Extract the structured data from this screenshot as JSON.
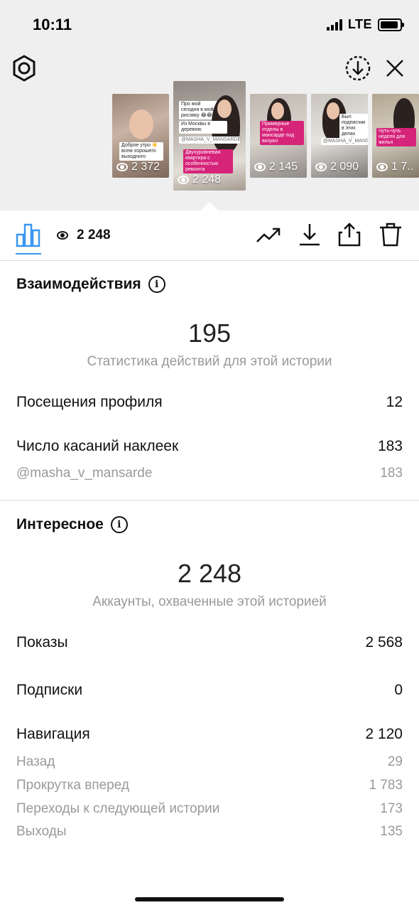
{
  "status_bar": {
    "time": "10:11",
    "network": "LTE"
  },
  "thumbnails": [
    {
      "views": "2 372",
      "selected": false
    },
    {
      "views": "2 248",
      "selected": true
    },
    {
      "views": "2 145",
      "selected": false
    },
    {
      "views": "2 090",
      "selected": false
    },
    {
      "views": "1 7..",
      "selected": false
    }
  ],
  "thumb_text": {
    "t1_sticker": "Доброе утро ☀️ всем хорошего выходного",
    "t2_top": "Про мой сегодня в мой рисовку 😂😂",
    "t2_sticker1": "Из Москвы в деревню",
    "t2_mention": "@MASHA_V_MANSARDE",
    "t2_sticker2": "Двухуровневая квартира с особенностью ремонта",
    "t3_sticker": "Примерные отделы в мансарде под визуал",
    "t4_sticker": "Был подписчик в этих делах профиле",
    "t4_mention": "@MASHA_V_MANSARDE",
    "t5_sticker": "Чуть-чуть неделя для жилья"
  },
  "toolbar": {
    "views_total": "2 248"
  },
  "interactions": {
    "title": "Взаимодействия",
    "total": "195",
    "caption": "Статистика действий для этой истории",
    "profile_visits_label": "Посещения профиля",
    "profile_visits_value": "12",
    "sticker_taps_label": "Число касаний наклеек",
    "sticker_taps_value": "183",
    "mention_label": "@masha_v_mansarde",
    "mention_value": "183"
  },
  "discovery": {
    "title": "Интересное",
    "reach": "2 248",
    "caption": "Аккаунты, охваченные этой историей",
    "impressions_label": "Показы",
    "impressions_value": "2 568",
    "follows_label": "Подписки",
    "follows_value": "0",
    "navigation_label": "Навигация",
    "navigation_value": "2 120",
    "back_label": "Назад",
    "back_value": "29",
    "forward_label": "Прокрутка вперед",
    "forward_value": "1 783",
    "next_story_label": "Переходы к следующей истории",
    "next_story_value": "173",
    "exits_label": "Выходы",
    "exits_value": "135"
  },
  "colors": {
    "accent": "#3897f0",
    "muted": "#999999",
    "background_top": "#efefef",
    "sticker_pink": "#d6247a"
  }
}
